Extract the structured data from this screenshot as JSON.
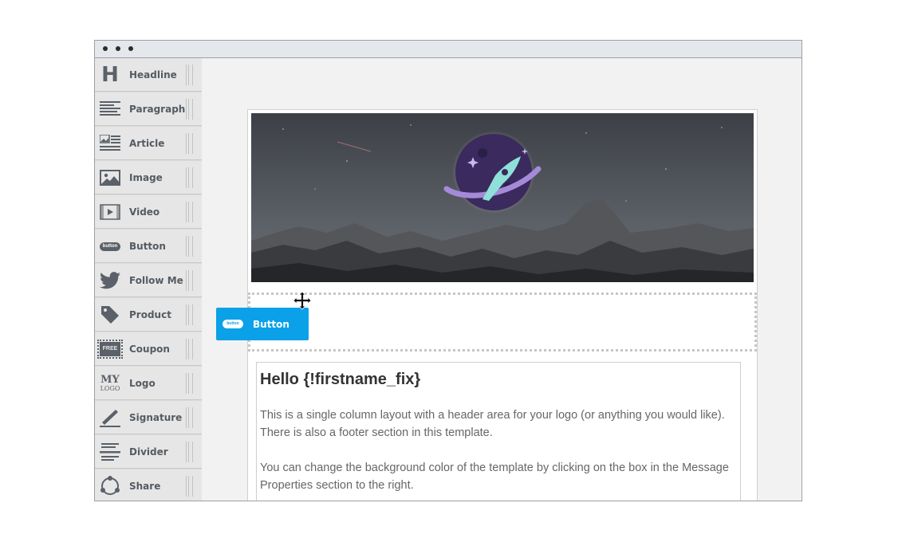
{
  "sidebar": {
    "items": [
      {
        "label": "Headline",
        "icon": "headline-icon"
      },
      {
        "label": "Paragraph",
        "icon": "paragraph-icon"
      },
      {
        "label": "Article",
        "icon": "article-icon"
      },
      {
        "label": "Image",
        "icon": "image-icon"
      },
      {
        "label": "Video",
        "icon": "video-icon"
      },
      {
        "label": "Button",
        "icon": "button-icon"
      },
      {
        "label": "Follow Me",
        "icon": "twitter-icon"
      },
      {
        "label": "Product",
        "icon": "tag-icon"
      },
      {
        "label": "Coupon",
        "icon": "coupon-icon"
      },
      {
        "label": "Logo",
        "icon": "logo-icon"
      },
      {
        "label": "Signature",
        "icon": "pen-icon"
      },
      {
        "label": "Divider",
        "icon": "divider-icon"
      },
      {
        "label": "Share",
        "icon": "share-icon"
      }
    ]
  },
  "headline_glyph": "H",
  "logo_glyph": {
    "line1": "MY",
    "line2": "LOGO"
  },
  "button_glyph": "button",
  "coupon_glyph": "FREE",
  "dragging": {
    "label": "Button",
    "pill": "button",
    "color": "#0aa1e8"
  },
  "email": {
    "greeting": "Hello {!firstname_fix}",
    "paragraphs": [
      "This is a single column layout with a header area for your logo (or anything you would like). There is also a footer section in this template.",
      "You can change the background color of the template by clicking on the box in the Message Properties section to the right."
    ]
  },
  "colors": {
    "accent": "#0aa1e8",
    "sidebar_text": "#555b62",
    "logo_purple": "#3a2a5e",
    "rocket": "#8fe0d8"
  }
}
